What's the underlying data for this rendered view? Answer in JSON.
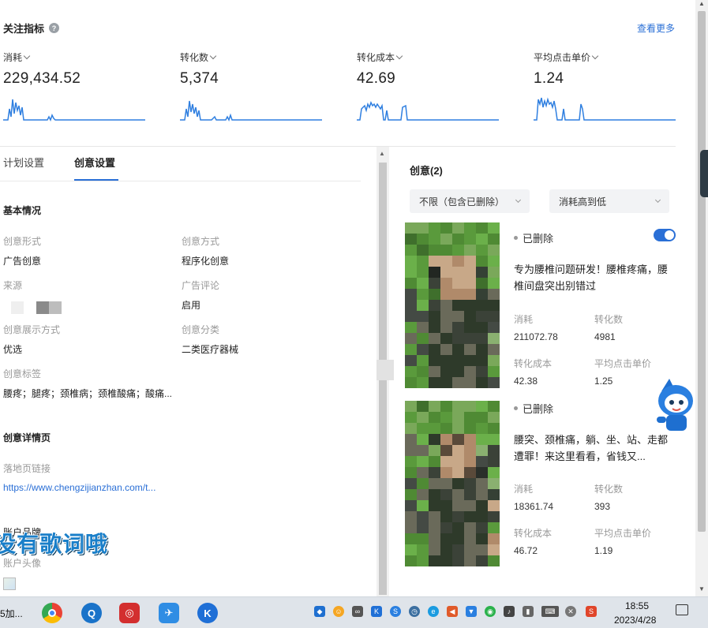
{
  "header": {
    "title": "关注指标",
    "more_link": "查看更多",
    "metrics": [
      {
        "label": "消耗",
        "value": "229,434.52"
      },
      {
        "label": "转化数",
        "value": "5,374"
      },
      {
        "label": "转化成本",
        "value": "42.69"
      },
      {
        "label": "平均点击单价",
        "value": "1.24"
      }
    ]
  },
  "tabs": [
    {
      "label": "计划设置",
      "active": false
    },
    {
      "label": "创意设置",
      "active": true
    }
  ],
  "basic_info": {
    "title": "基本情况",
    "fields": {
      "creative_form": {
        "label": "创意形式",
        "value": "广告创意"
      },
      "creative_method": {
        "label": "创意方式",
        "value": "程序化创意"
      },
      "source": {
        "label": "来源"
      },
      "ad_comment": {
        "label": "广告评论",
        "value": "启用"
      },
      "display_mode": {
        "label": "创意展示方式",
        "value": "优选"
      },
      "category": {
        "label": "创意分类",
        "value": "二类医疗器械"
      },
      "tags": {
        "label": "创意标签",
        "value": "腰疼；腿疼；颈椎病；颈椎酸痛；酸痛..."
      }
    }
  },
  "detail_page": {
    "title": "创意详情页",
    "landing_label": "落地页链接",
    "landing_url": "https://www.chengzijianzhan.com/t...",
    "account_brand": "账户品牌",
    "account_avatar": "账户头像"
  },
  "watermark": "没有歌词哦",
  "creatives": {
    "title": "创意(2)",
    "filter": "不限（包含已删除）",
    "sort": "消耗高到低",
    "cards": [
      {
        "status": "已删除",
        "toggle_on": true,
        "description": "专为腰椎问题研发！腰椎疼痛，腰椎间盘突出别错过",
        "stats": [
          {
            "label": "消耗",
            "value": "211072.78"
          },
          {
            "label": "转化数",
            "value": "4981"
          },
          {
            "label": "转化成本",
            "value": "42.38"
          },
          {
            "label": "平均点击单价",
            "value": "1.25"
          }
        ]
      },
      {
        "status": "已删除",
        "toggle_on": false,
        "description": "腰突、颈椎痛，躺、坐、站、走都遭罪！来这里看看，省钱又...",
        "stats": [
          {
            "label": "消耗",
            "value": "18361.74"
          },
          {
            "label": "转化数",
            "value": "393"
          },
          {
            "label": "转化成本",
            "value": "46.72"
          },
          {
            "label": "平均点击单价",
            "value": "1.19"
          }
        ]
      }
    ]
  },
  "taskbar": {
    "left_text": "5加...",
    "time": "18:55",
    "date": "2023/4/28"
  },
  "colors": {
    "accent": "#2a6fd6",
    "sparkline": "#2f7fe0"
  }
}
